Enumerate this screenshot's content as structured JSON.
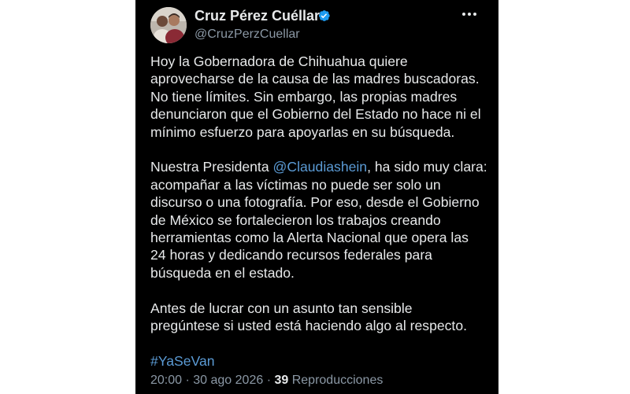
{
  "author": {
    "display_name": "Cruz Pérez Cuéllar",
    "handle": "@CruzPerzCuellar",
    "verified_icon": "verified-badge-icon",
    "avatar_icon": "profile-photo"
  },
  "tweet": {
    "paragraph1": "Hoy la Gobernadora de Chihuahua quiere\naprovecharse de la causa de las madres buscadoras.\nNo tiene límites. Sin embargo, las propias madres\ndenunciaron que el Gobierno del Estado no hace ni el\nmínimo esfuerzo para apoyarlas en su búsqueda.",
    "paragraph2_pre": "Nuestra Presidenta ",
    "mention": "@Claudiashein",
    "paragraph2_post": ", ha sido muy clara:\nacompañar a las víctimas no puede ser solo un\ndiscurso o una fotografía. Por eso, desde el Gobierno\nde México se fortalecieron los trabajos creando\nherramientas como la Alerta Nacional que opera las\n24 horas y dedicando recursos federales para\nbúsqueda en el estado.",
    "paragraph3": "Antes de lucrar con un asunto tan sensible\npregúntese si usted está haciendo algo al respecto.",
    "hashtag": "#YaSeVan"
  },
  "meta": {
    "time": "20:00",
    "separator": " · ",
    "date": "30 ago 2026",
    "views_count": "39",
    "views_label": " Reproducciones"
  },
  "colors": {
    "background": "#000000",
    "text": "#e7e9ea",
    "secondary": "#8b98a5",
    "link": "#5b9bd5",
    "verified": "#1d9bf0"
  }
}
